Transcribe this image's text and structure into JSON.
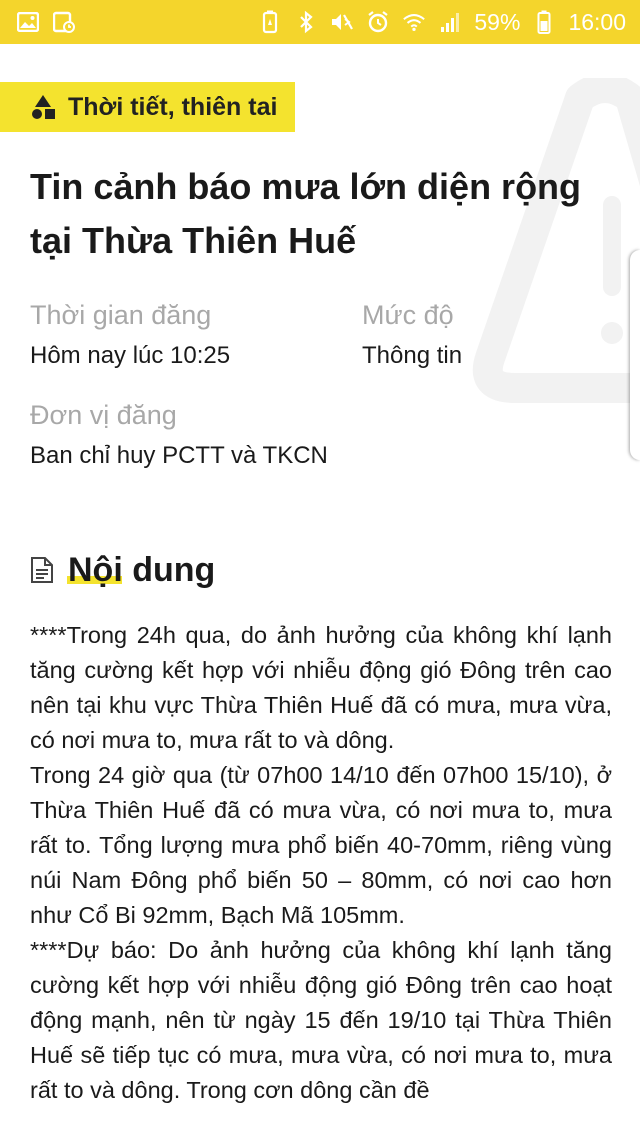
{
  "status_bar": {
    "battery_percent": "59%",
    "time": "16:00",
    "icons": [
      "image-icon",
      "calendar-icon",
      "battery-saver-icon",
      "bluetooth-icon",
      "mute-icon",
      "alarm-icon",
      "wifi-icon",
      "signal-icon",
      "battery-icon"
    ]
  },
  "category": {
    "label": "Thời tiết, thiên tai",
    "icon": "shapes-icon"
  },
  "title": "Tin cảnh báo mưa lớn diện rộng tại Thừa Thiên Huế",
  "meta": {
    "posted_time_label": "Thời gian đăng",
    "posted_time_value": "Hôm nay lúc 10:25",
    "level_label": "Mức độ",
    "level_value": "Thông tin",
    "unit_label": "Đơn vị đăng",
    "unit_value": "Ban chỉ huy PCTT và TKCN"
  },
  "content": {
    "heading": "Nội dung",
    "paragraphs": [
      "****Trong 24h qua, do ảnh hưởng của không khí lạnh tăng cường kết hợp với nhiễu động gió Đông trên cao nên tại khu vực Thừa Thiên Huế đã có mưa, mưa vừa, có nơi mưa to, mưa rất to và dông.",
      "Trong 24 giờ qua (từ 07h00 14/10 đến 07h00 15/10), ở Thừa Thiên Huế đã có mưa vừa, có nơi mưa to, mưa rất to. Tổng lượng mưa phổ biến 40-70mm, riêng vùng núi Nam Đông phổ biến 50 – 80mm, có nơi cao hơn như Cổ Bi 92mm, Bạch Mã 105mm.",
      "****Dự báo: Do ảnh hưởng của không khí lạnh tăng cường kết hợp với nhiễu động gió Đông trên cao hoạt động mạnh, nên từ ngày 15 đến 19/10 tại Thừa Thiên Huế sẽ tiếp tục có mưa, mưa vừa, có nơi mưa to, mưa rất to và dông. Trong cơn dông cần đề"
    ]
  },
  "colors": {
    "status_bar": "#f4d52c",
    "accent": "#f4e32e"
  }
}
